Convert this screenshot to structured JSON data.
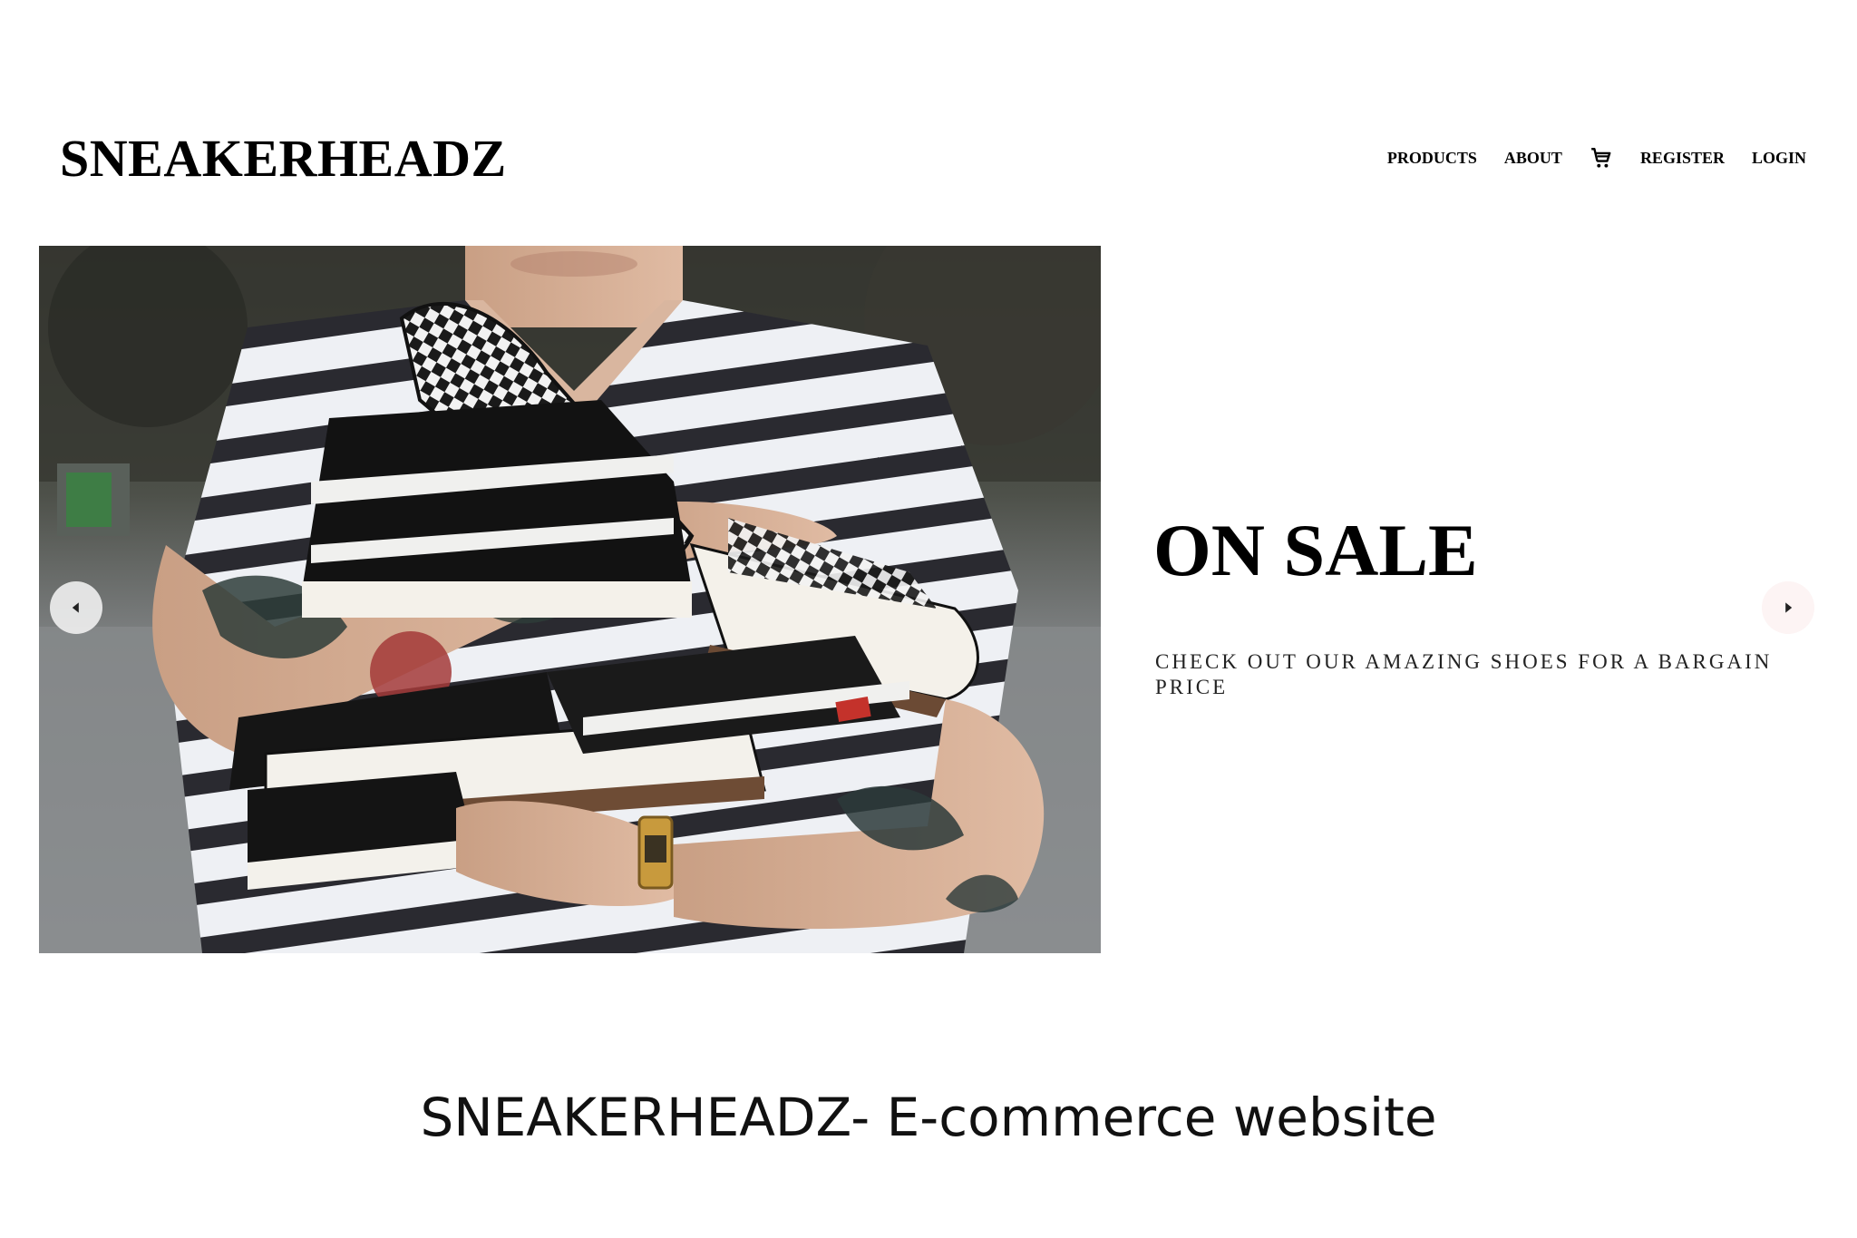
{
  "header": {
    "brand": "SNEAKERHEADZ",
    "nav": {
      "products": "PRODUCTS",
      "about": "ABOUT",
      "cart_icon": "cart-icon",
      "register": "REGISTER",
      "login": "LOGIN"
    }
  },
  "hero": {
    "image_alt": "Person in striped shirt holding several pairs of checkered and black-and-white Vans sneakers",
    "title": "ON SALE",
    "subtitle": "CHECK OUT OUR AMAZING SHOES FOR A BARGAIN PRICE",
    "prev_icon": "caret-left-icon",
    "next_icon": "caret-right-icon"
  },
  "caption": "SNEAKERHEADZ- E-commerce website"
}
